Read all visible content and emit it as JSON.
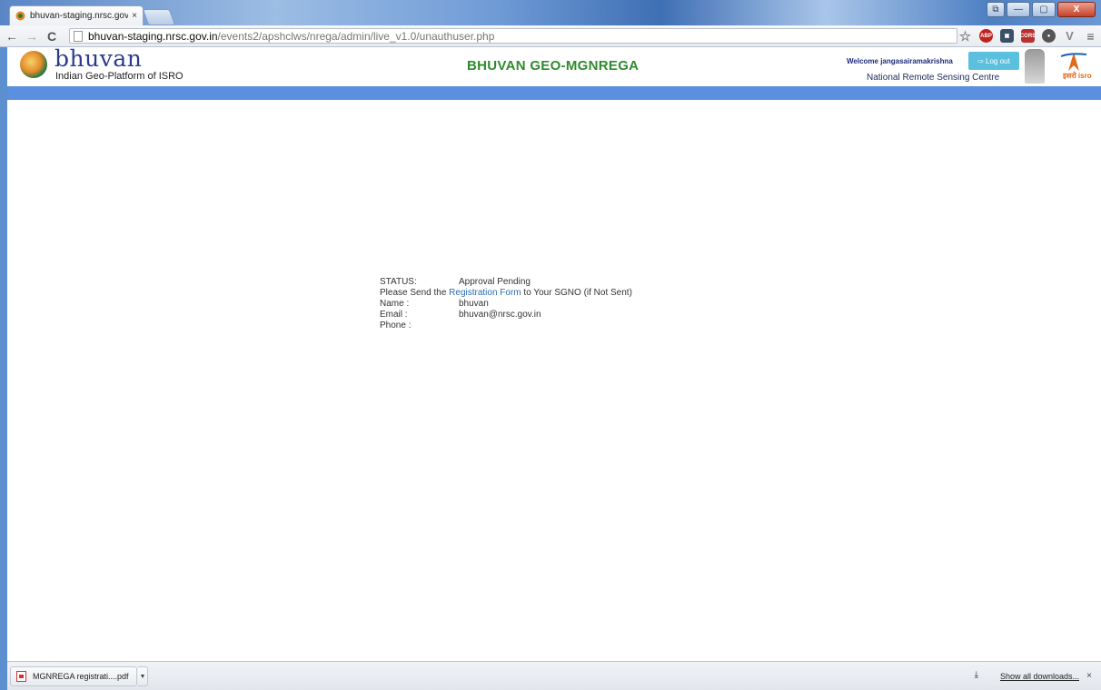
{
  "browser": {
    "tab_title": "bhuvan-staging.nrsc.gov.i",
    "tab_close": "×",
    "url_host": "bhuvan-staging.nrsc.gov.in",
    "url_path": "/events2/apshclws/nrega/admin/live_v1.0/unauthuser.php",
    "back": "←",
    "forward": "→",
    "reload": "C",
    "min": "—",
    "max": "▢",
    "close": "X",
    "ext_abp": "ABP",
    "ext_cors": "CORS",
    "star": "☆",
    "menu": "≡"
  },
  "header": {
    "logo_text": "bhuvan",
    "tagline": "Indian Geo-Platform of ISRO",
    "site_title": "BHUVAN GEO-MGNREGA",
    "welcome": "Welcome jangasairamakrishna",
    "logout_label": "Log out",
    "nrsc": "National Remote Sensing Centre",
    "isro_label": "इसरो isro"
  },
  "status": {
    "status_label": "STATUS:",
    "status_value": "Approval Pending",
    "send_prefix": "Please Send the ",
    "send_link": "Registration Form",
    "send_suffix": " to Your SGNO (if Not Sent)",
    "name_label": "Name :",
    "name_value": "bhuvan",
    "email_label": "Email :",
    "email_value": "bhuvan@nrsc.gov.in",
    "phone_label": "Phone :",
    "phone_value": ""
  },
  "downloads": {
    "file_name": "MGNREGA registrati....pdf",
    "show_all": "Show all downloads...",
    "close": "×"
  },
  "colors": {
    "accent_blue": "#5b8fe0",
    "title_green": "#2f8a2f",
    "logout_bg": "#5bc0de",
    "link": "#2a6db0"
  }
}
